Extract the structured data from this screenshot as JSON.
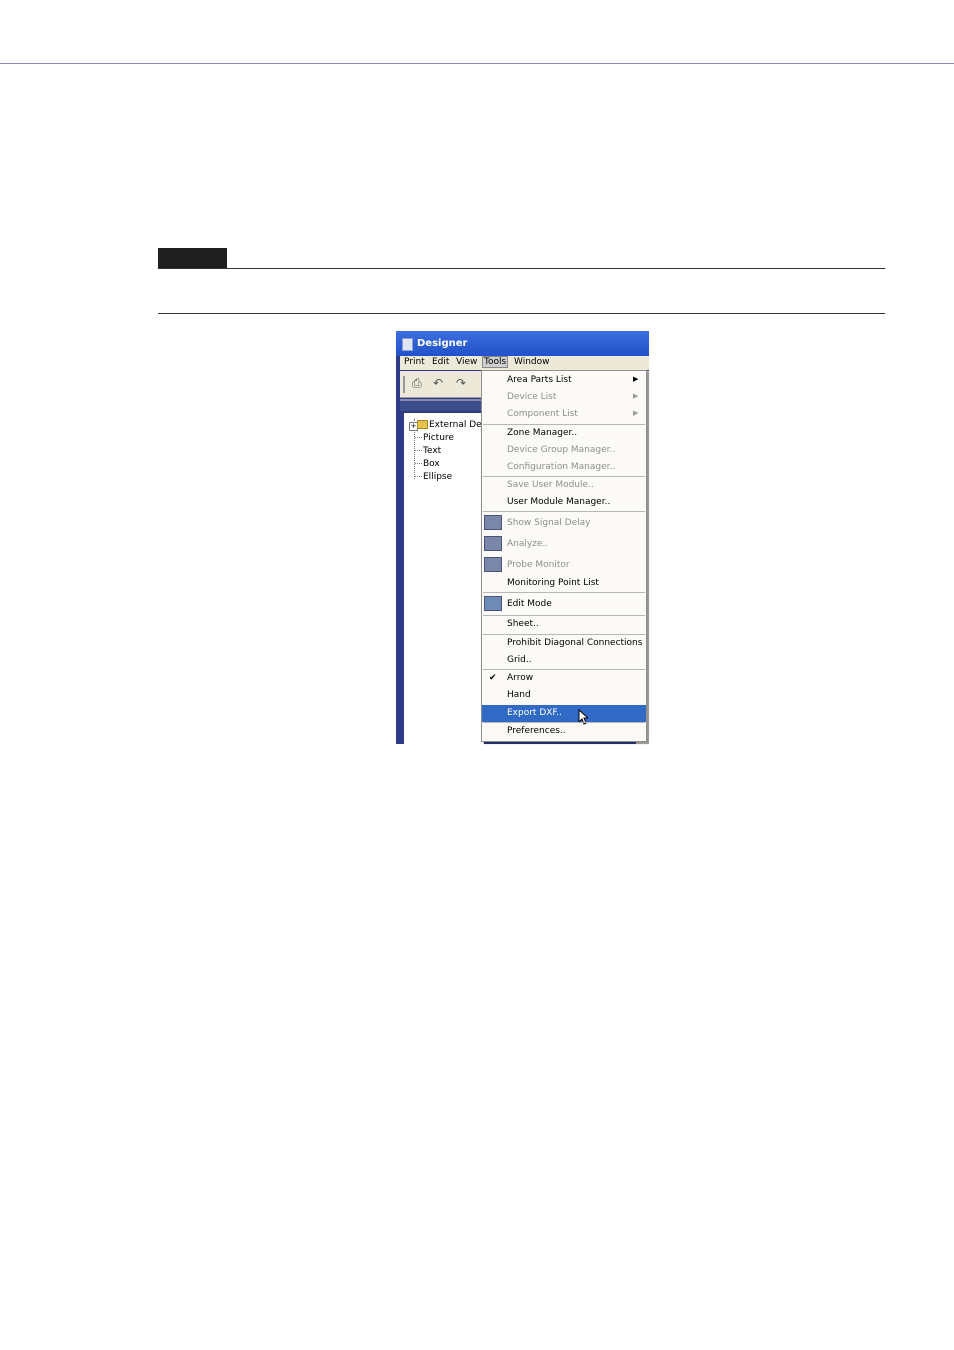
{
  "window": {
    "title": "Designer"
  },
  "menubar": {
    "items": [
      "Print",
      "Edit",
      "View",
      "Tools",
      "Window"
    ]
  },
  "tree": {
    "items": [
      "External De",
      "Picture",
      "Text",
      "Box",
      "Ellipse"
    ]
  },
  "menu": {
    "items": [
      "Area Parts List",
      "Device List",
      "Component List",
      "Zone Manager..",
      "Device Group Manager..",
      "Configuration Manager..",
      "Save User Module..",
      "User Module Manager..",
      "Show Signal Delay",
      "Analyze..",
      "Probe Monitor",
      "Monitoring Point List",
      "Edit Mode",
      "Sheet..",
      "Prohibit Diagonal Connections",
      "Grid..",
      "Arrow",
      "Hand",
      "Export DXF..",
      "Preferences.."
    ],
    "checked_item": "Arrow",
    "selected_item": "Export DXF.."
  },
  "icons": {
    "app": "designer-app-icon",
    "toolbar": [
      "print-icon",
      "undo-icon",
      "redo-icon"
    ],
    "menu": [
      "signal-delay-icon",
      "analyze-icon",
      "probe-monitor-icon",
      "edit-mode-icon"
    ],
    "cursor": "mouse-pointer-icon"
  },
  "colors": {
    "page_rule": "#8a86b8",
    "menu_highlight": "#316ac5",
    "window_frame": "#2f3a86"
  }
}
